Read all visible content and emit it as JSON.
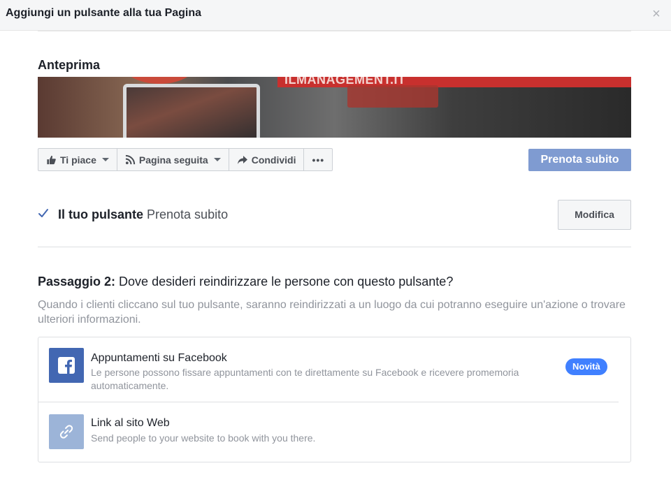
{
  "dialog": {
    "title": "Aggiungi un pulsante alla tua Pagina",
    "close_icon": "×"
  },
  "preview": {
    "section_title": "Anteprima",
    "cover_text": "ILMANAGEMENT.IT",
    "actions": [
      {
        "label": "Ti piace",
        "icon": "thumbs-up-icon",
        "has_caret": true
      },
      {
        "label": "Pagina seguita",
        "icon": "rss-icon",
        "has_caret": true
      },
      {
        "label": "Condividi",
        "icon": "share-icon",
        "has_caret": false
      },
      {
        "label": "•••",
        "icon": "more-icon",
        "has_caret": false
      }
    ],
    "cta_label": "Prenota subito"
  },
  "your_button": {
    "label_bold": "Il tuo pulsante",
    "label_value": " Prenota subito",
    "modify_label": "Modifica"
  },
  "step2": {
    "title_bold": "Passaggio 2:",
    "title_text": " Dove desideri reindirizzare le persone con questo pulsante?",
    "description": "Quando i clienti cliccano sul tuo pulsante, saranno reindirizzati a un luogo da cui potranno eseguire un'azione o trovare ulteriori informazioni."
  },
  "options": [
    {
      "title": "Appuntamenti su Facebook",
      "description": "Le persone possono fissare appuntamenti con te direttamente su Facebook e ricevere promemoria automaticamente.",
      "badge": "Novità",
      "icon": "facebook-icon"
    },
    {
      "title": "Link al sito Web",
      "description": "Send people to your website to book with you there.",
      "icon": "link-icon"
    }
  ],
  "colors": {
    "brand_blue": "#4267b2",
    "cta_blue": "#7f9bd1",
    "badge_blue": "#4080ff",
    "link_icon_bg": "#9cb4d8"
  }
}
